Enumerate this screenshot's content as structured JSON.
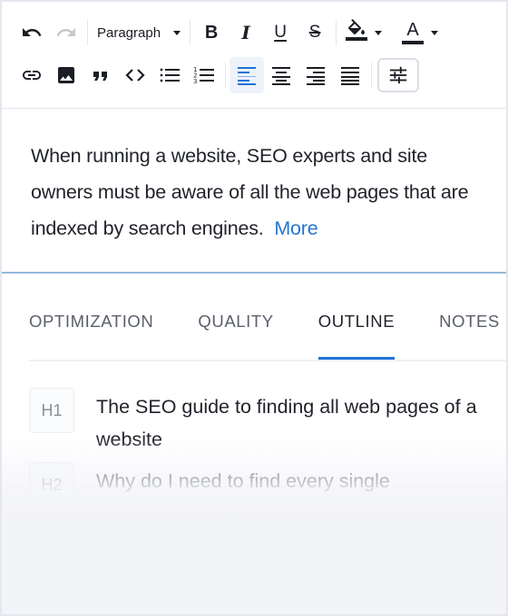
{
  "toolbar": {
    "row1": [
      {
        "name": "undo",
        "icon": "undo-icon",
        "enabled": true
      },
      {
        "name": "redo",
        "icon": "redo-icon",
        "enabled": false
      },
      {
        "name": "block-format",
        "type": "dropdown"
      },
      {
        "name": "bold",
        "label": "B"
      },
      {
        "name": "italic",
        "label": "I"
      },
      {
        "name": "underline",
        "label": "U"
      },
      {
        "name": "strikethrough",
        "label": "S"
      },
      {
        "name": "highlight-color",
        "icon": "paint-bucket-icon",
        "type": "split-dropdown"
      },
      {
        "name": "text-color",
        "label": "A",
        "type": "split-dropdown"
      }
    ],
    "block_format_value": "Paragraph",
    "bold_label": "B",
    "italic_label": "I",
    "underline_label": "U",
    "strike_label": "S",
    "text_color_label": "A",
    "row2": [
      {
        "name": "link",
        "icon": "link-icon"
      },
      {
        "name": "image",
        "icon": "image-icon"
      },
      {
        "name": "blockquote",
        "icon": "quote-icon"
      },
      {
        "name": "code",
        "icon": "code-icon"
      },
      {
        "name": "bulleted-list",
        "icon": "bulleted-list-icon"
      },
      {
        "name": "numbered-list",
        "icon": "numbered-list-icon"
      },
      {
        "name": "align-left",
        "icon": "align-left-icon",
        "active": true
      },
      {
        "name": "align-center",
        "icon": "align-center-icon"
      },
      {
        "name": "align-right",
        "icon": "align-right-icon"
      },
      {
        "name": "align-justify",
        "icon": "align-justify-icon"
      },
      {
        "name": "settings",
        "icon": "sliders-icon"
      }
    ],
    "colors": {
      "active_align": "#1e75d4",
      "icon": "#1a1d24",
      "disabled": "#c6c8ce"
    }
  },
  "content": {
    "paragraph": "When running a website, SEO experts and site owners must be aware of all the web pages that are indexed by search engines.",
    "more_link": "More",
    "link_color": "#2576d2"
  },
  "tabs": {
    "items": [
      {
        "label": "OPTIMIZATION",
        "active": false
      },
      {
        "label": "QUALITY",
        "active": false
      },
      {
        "label": "OUTLINE",
        "active": true
      },
      {
        "label": "NOTES",
        "active": false
      }
    ],
    "accent": "#1e75d4"
  },
  "outline": {
    "items": [
      {
        "level": "H1",
        "text": "The SEO guide to finding all web pages of a website"
      },
      {
        "level": "H2",
        "text": "Why do I need to find every single"
      }
    ]
  }
}
